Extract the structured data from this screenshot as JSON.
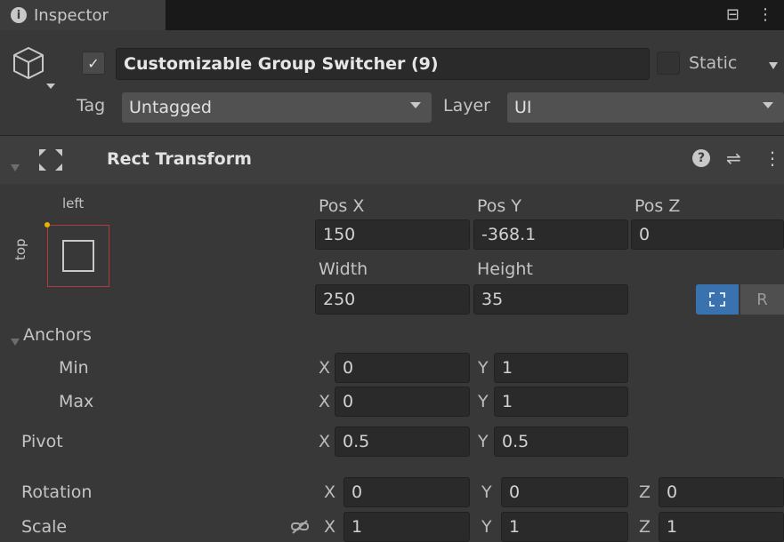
{
  "window": {
    "tab_title": "Inspector",
    "info_glyph": "i",
    "lock_glyph": "⊟",
    "menu_glyph": "⋮"
  },
  "header": {
    "active_checked": true,
    "check_glyph": "✓",
    "object_name": "Customizable Group Switcher (9)",
    "static_label": "Static",
    "static_checked": false,
    "tag_label": "Tag",
    "tag_value": "Untagged",
    "layer_label": "Layer",
    "layer_value": "UI"
  },
  "component": {
    "title": "Rect Transform",
    "help_glyph": "?",
    "preset_glyph": "⇌",
    "menu_glyph": "⋮"
  },
  "anchor_preset": {
    "horizontal_label": "left",
    "vertical_label": "top"
  },
  "rect": {
    "posx_label": "Pos X",
    "posy_label": "Pos Y",
    "posz_label": "Pos Z",
    "posx": "150",
    "posy": "-368.1",
    "posz": "0",
    "width_label": "Width",
    "height_label": "Height",
    "width": "250",
    "height": "35",
    "r_button": "R"
  },
  "anchors": {
    "label": "Anchors",
    "min_label": "Min",
    "max_label": "Max",
    "min_x": "0",
    "min_y": "1",
    "max_x": "0",
    "max_y": "1"
  },
  "pivot": {
    "label": "Pivot",
    "x": "0.5",
    "y": "0.5"
  },
  "rotation": {
    "label": "Rotation",
    "x": "0",
    "y": "0",
    "z": "0"
  },
  "scale": {
    "label": "Scale",
    "x": "1",
    "y": "1",
    "z": "1"
  },
  "axis": {
    "x": "X",
    "y": "Y",
    "z": "Z"
  },
  "colors": {
    "accent": "#3a72b0",
    "panel": "#383838",
    "field": "#2a2a2a",
    "anchor_red": "#b13a3a",
    "anchor_dot": "#e8b300"
  }
}
